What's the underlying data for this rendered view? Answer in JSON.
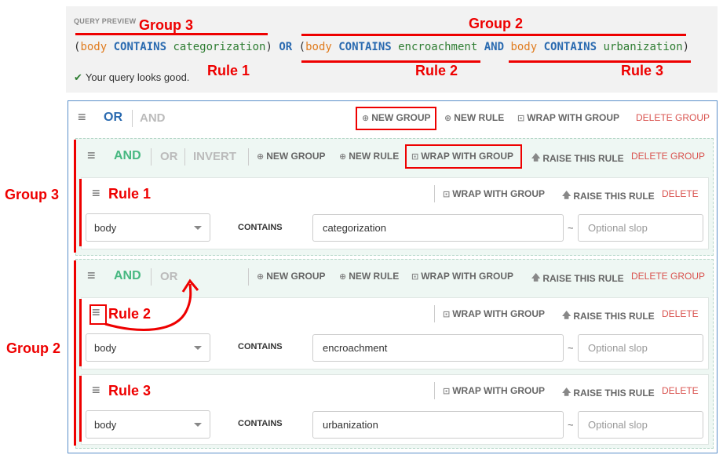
{
  "preview": {
    "title": "QUERY PREVIEW",
    "status": "Your query looks good.",
    "q": {
      "lp": "(",
      "rp": ")",
      "field": "body",
      "contains": "CONTAINS",
      "or": "OR",
      "and": "AND",
      "v1": "categorization",
      "v2": "encroachment",
      "v3": "urbanization"
    }
  },
  "annotations": {
    "group3": "Group 3",
    "group2": "Group 2",
    "rule1": "Rule 1",
    "rule2": "Rule 2",
    "rule3": "Rule 3"
  },
  "root": {
    "combinator_active": "OR",
    "combinator_inactive": "AND",
    "new_group": "NEW GROUP",
    "new_rule": "NEW RULE",
    "wrap": "WRAP WITH GROUP",
    "delete_group": "DELETE GROUP"
  },
  "group3": {
    "combinator_active": "AND",
    "combinator_inactive": "OR",
    "invert": "INVERT",
    "new_group": "NEW GROUP",
    "new_rule": "NEW RULE",
    "wrap": "WRAP WITH GROUP",
    "raise": "RAISE THIS RULE",
    "delete_group": "DELETE GROUP"
  },
  "group2": {
    "combinator_active": "AND",
    "combinator_inactive": "OR",
    "new_group": "NEW GROUP",
    "new_rule": "NEW RULE",
    "wrap": "WRAP WITH GROUP",
    "raise": "RAISE THIS RULE",
    "delete_group": "DELETE GROUP"
  },
  "rule_actions": {
    "wrap": "WRAP WITH GROUP",
    "raise": "RAISE THIS RULE",
    "delete": "DELETE"
  },
  "rules": [
    {
      "field": "body",
      "operator": "CONTAINS",
      "value": "categorization",
      "slop_placeholder": "Optional slop",
      "tilde": "~"
    },
    {
      "field": "body",
      "operator": "CONTAINS",
      "value": "encroachment",
      "slop_placeholder": "Optional slop",
      "tilde": "~"
    },
    {
      "field": "body",
      "operator": "CONTAINS",
      "value": "urbanization",
      "slop_placeholder": "Optional slop",
      "tilde": "~"
    }
  ],
  "icons": {
    "plus": "plus-circle-icon",
    "wrap": "wrap-icon",
    "raise": "arrow-up-icon",
    "drag": "drag-handle-icon",
    "check": "check-icon"
  },
  "colors": {
    "annotation": "#e00000",
    "field": "#e07c1f",
    "operator": "#2a6ab0",
    "value": "#2e7d32",
    "delete": "#d9534f",
    "and_active": "#47b881"
  }
}
